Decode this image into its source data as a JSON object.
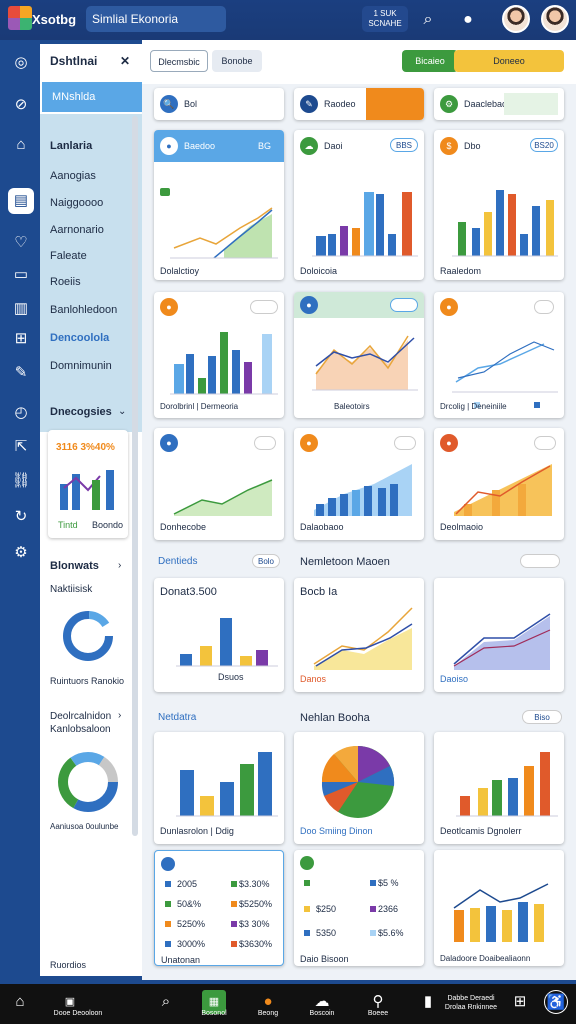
{
  "app": {
    "short_name": "Xsotbg",
    "title": "Simlial Ekonoria",
    "notification": "1 SUK\nSCNAHE"
  },
  "sidebar": {
    "heading": "Dshtlnai",
    "selected": "MNshlda",
    "items": [
      "Lanlaria",
      "Aanogias",
      "Naiggoooo",
      "Aarnonario",
      "Faleate",
      "Roeiis",
      "Banlohledoon",
      "Dencoolola",
      "Domnimunin"
    ],
    "sec1": "Dnecogsies",
    "mini_top": "3116 3%40%",
    "mini_left": "Tintd",
    "mini_right": "Boondo",
    "sec2": "Blonwats",
    "sec2_sub": "Naktiisisk",
    "ring_caption": "Ruintuors Ranokio",
    "sec3": "Deolrcalnidon Kanlobsaloon",
    "ring2_caption": "Aaniusoa 0oulunbe",
    "bottom": "Ruordios"
  },
  "toolbar": {
    "btn1": "Dlecmsbic",
    "btn2": "Bonobe",
    "btn3": "Bicaieo",
    "btn4": "Doneeo"
  },
  "row0": [
    {
      "icon": "🔍",
      "label": "Bol"
    },
    {
      "icon": "✎",
      "label": "Raodeo"
    },
    {
      "icon": "⚙",
      "label": "Daaclebac"
    }
  ],
  "cards": [
    {
      "head": "Baedoo",
      "badge": "BG",
      "caption": "Dolalctioy"
    },
    {
      "head": "Daoi",
      "badge": "BBS",
      "caption": "Doloicoia"
    },
    {
      "head": "Dbo",
      "badge": "BS20",
      "caption": "Raaledom"
    },
    {
      "head": "",
      "badge": "",
      "caption": "Dorolbrinl | Dermeoria"
    },
    {
      "head": "",
      "badge": "",
      "caption": "Baleotoirs"
    },
    {
      "head": "",
      "badge": "",
      "caption": "Drcolig | Deneiniile"
    },
    {
      "head": "",
      "badge": "",
      "caption": "Donhecobe"
    },
    {
      "head": "",
      "badge": "",
      "caption": "Dalaobaoo"
    },
    {
      "head": "",
      "badge": "",
      "caption": "Deolmaoio"
    }
  ],
  "section2": {
    "left": "Dentieds",
    "left_btn": "Bolo",
    "right": "Nemletoon Maoen"
  },
  "row3": [
    {
      "title": "Donat3.500",
      "caption": "Dsuos"
    },
    {
      "title": "Bocb Ia",
      "caption": "Danos"
    },
    {
      "title": "",
      "caption": "Daoiso"
    }
  ],
  "section3": {
    "left": "Netdatra",
    "right": "Nehlan Booha",
    "right_btn": "Biso"
  },
  "row4": [
    {
      "caption": "Dunlasrolon | Ddig"
    },
    {
      "caption": "Doo Smiing Dinon"
    },
    {
      "caption": "Deotlcamis Dgnolerr"
    }
  ],
  "row5": [
    {
      "rows": [
        [
          "2005",
          "$3.30%"
        ],
        [
          "50&%",
          "$5250%"
        ],
        [
          "5250%",
          "$3 30%"
        ],
        [
          "3000%",
          "$3630%"
        ]
      ],
      "caption": "Unatonan"
    },
    {
      "rows": [
        [
          "",
          "$5 %"
        ],
        [
          "$250",
          "2366"
        ],
        [
          "5350",
          "$5.6%"
        ]
      ],
      "caption": "Daio Bisoon"
    },
    {
      "caption": "Daladoore Doaibealiaonn"
    }
  ],
  "bottom_nav": [
    "Dooe Deooloon",
    "Bosonol",
    "Beong",
    "Boscoin",
    "Boeee",
    "Dabbe Deraedi\nDrolaa Rnkinnee"
  ],
  "colors": {
    "accent": "#1d4a8f",
    "blue": "#2f6fc0",
    "green": "#3c9a3e",
    "orange": "#f08a1c",
    "yellow": "#f3c33c",
    "purple": "#7a3aa8",
    "red": "#e05a2b"
  }
}
